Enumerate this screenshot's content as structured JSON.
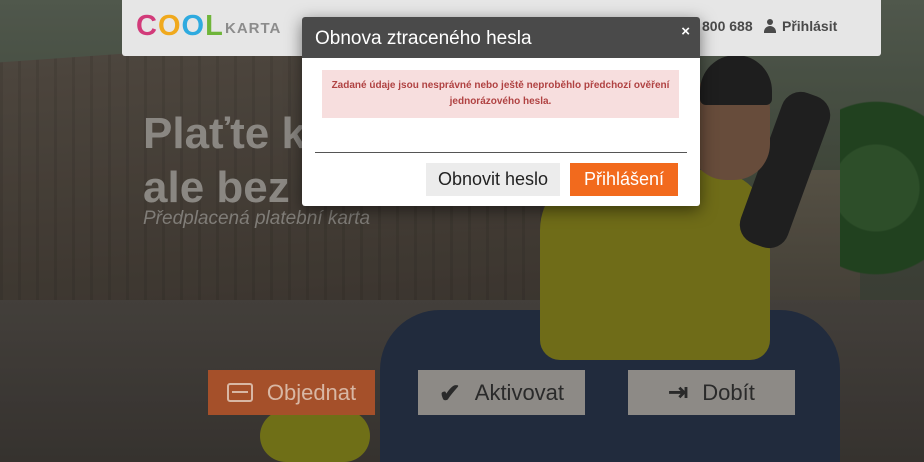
{
  "header": {
    "logo_cool": [
      "C",
      "O",
      "O",
      "L"
    ],
    "logo_karta": "KARTA",
    "phone_partial": "800 688",
    "login_label": "Přihlásit"
  },
  "hero": {
    "line1": "Plaťte k",
    "line2": "ale bez",
    "subtitle": "Předplacená platební karta"
  },
  "actions": {
    "order_label": "Objednat",
    "activate_label": "Aktivovat",
    "topup_label": "Dobít"
  },
  "modal": {
    "title": "Obnova ztraceného hesla",
    "close_glyph": "×",
    "error_text": "Zadané údaje jsou nesprávné nebo ještě neproběhlo předchozí ověření jednorázového hesla.",
    "reset_button": "Obnovit heslo",
    "login_button": "Přihlášení"
  },
  "colors": {
    "accent_orange": "#f26a1d",
    "header_dark": "#4a4a4a",
    "alert_bg": "#f7dede",
    "alert_text": "#b04242"
  },
  "icons": {
    "login": "user-icon",
    "order": "credit-card-icon",
    "activate": "checkmark-icon",
    "topup": "sign-in-icon",
    "modal_close": "close-icon"
  }
}
